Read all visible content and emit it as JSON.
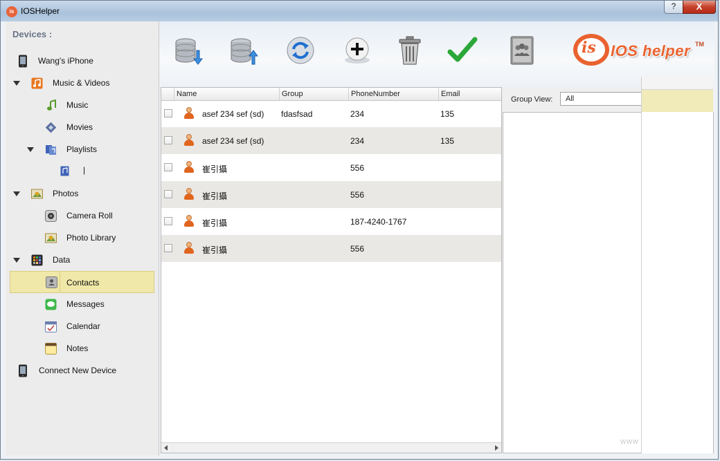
{
  "window": {
    "title": "IOSHelper",
    "help_label": "?",
    "close_label": "X"
  },
  "sidebar": {
    "devices_label": "Devices :",
    "items": [
      {
        "label": "Wang's iPhone",
        "icon": "iphone-icon",
        "color": "#333333"
      },
      {
        "label": "Music & Videos",
        "icon": "music-videos-icon",
        "color": "#e87722"
      },
      {
        "label": "Music",
        "icon": "music-note-icon",
        "color": "#5a9a2a"
      },
      {
        "label": "Movies",
        "icon": "movie-icon",
        "color": "#5a6fa0"
      },
      {
        "label": "Playlists",
        "icon": "playlist-icon",
        "color": "#3f63b8"
      },
      {
        "label": "|",
        "icon": "playlist-item-icon",
        "color": "#3f63b8"
      },
      {
        "label": "Photos",
        "icon": "photos-icon",
        "color": "#d9a520"
      },
      {
        "label": "Camera Roll",
        "icon": "camera-icon",
        "color": "#555555"
      },
      {
        "label": "Photo Library",
        "icon": "photo-library-icon",
        "color": "#d9a520"
      },
      {
        "label": "Data",
        "icon": "data-grid-icon",
        "color": "#444444"
      },
      {
        "label": "Contacts",
        "icon": "contacts-icon",
        "color": "#8a8a8a"
      },
      {
        "label": "Messages",
        "icon": "messages-icon",
        "color": "#3fb84a"
      },
      {
        "label": "Calendar",
        "icon": "calendar-icon",
        "color": "#6a7fb0"
      },
      {
        "label": "Notes",
        "icon": "notes-icon",
        "color": "#f0d070"
      },
      {
        "label": "Connect New Device",
        "icon": "connect-device-icon",
        "color": "#333333"
      }
    ]
  },
  "toolbar": {
    "buttons": [
      {
        "name": "import-button",
        "icon": "database-import-icon"
      },
      {
        "name": "export-button",
        "icon": "database-export-icon"
      },
      {
        "name": "refresh-button",
        "icon": "refresh-icon"
      },
      {
        "name": "add-button",
        "icon": "add-icon"
      },
      {
        "name": "delete-button",
        "icon": "trash-icon"
      },
      {
        "name": "confirm-button",
        "icon": "checkmark-icon"
      },
      {
        "name": "address-book-button",
        "icon": "address-book-icon"
      }
    ],
    "logo_is": "is",
    "logo_text": "IOS helper",
    "logo_tm": "TM"
  },
  "contacts": {
    "columns": [
      "Name",
      "Group",
      "PhoneNumber",
      "Email"
    ],
    "rows": [
      {
        "name": "asef 234 sef (sd)",
        "group": "fdasfsad",
        "phone": "234",
        "email": "135"
      },
      {
        "name": "asef 234 sef (sd)",
        "group": "",
        "phone": "234",
        "email": "135"
      },
      {
        "name": "崔引攝",
        "group": "",
        "phone": "556",
        "email": ""
      },
      {
        "name": "崔引攝",
        "group": "",
        "phone": "556",
        "email": ""
      },
      {
        "name": "崔引攝",
        "group": "",
        "phone": "187-4240-1767",
        "email": ""
      },
      {
        "name": "崔引攝",
        "group": "",
        "phone": "556",
        "email": ""
      }
    ]
  },
  "group_view": {
    "label": "Group View:",
    "selected": "All"
  },
  "watermark": "www"
}
